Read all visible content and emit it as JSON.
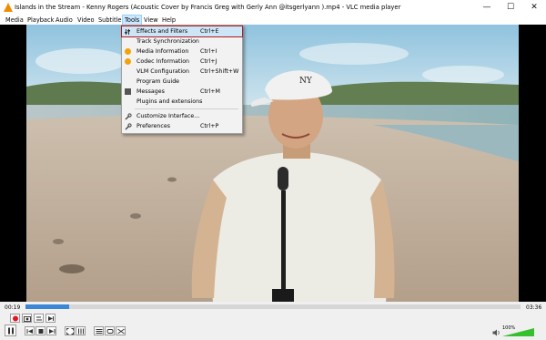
{
  "window": {
    "title": "Islands in the Stream - Kenny Rogers (Acoustic Cover by Francis Greg with Gerly Ann @itsgerlyann ).mp4 - VLC media player",
    "minimize_glyph": "—",
    "maximize_glyph": "☐",
    "close_glyph": "✕"
  },
  "menubar": {
    "items": [
      {
        "label": "Media"
      },
      {
        "label": "Playback"
      },
      {
        "label": "Audio"
      },
      {
        "label": "Video"
      },
      {
        "label": "Subtitle"
      },
      {
        "label": "Tools"
      },
      {
        "label": "View"
      },
      {
        "label": "Help"
      }
    ],
    "open_menu": "Tools"
  },
  "tools_menu": {
    "items": [
      {
        "label": "Effects and Filters",
        "shortcut": "Ctrl+E",
        "icon": "equalizer-icon",
        "highlighted": true
      },
      {
        "label": "Track Synchronization",
        "shortcut": "",
        "icon": ""
      },
      {
        "label": "Media Information",
        "shortcut": "Ctrl+I",
        "icon": "info-warning-icon"
      },
      {
        "label": "Codec Information",
        "shortcut": "Ctrl+J",
        "icon": "info-warning-icon"
      },
      {
        "label": "VLM Configuration",
        "shortcut": "Ctrl+Shift+W",
        "icon": ""
      },
      {
        "label": "Program Guide",
        "shortcut": "",
        "icon": ""
      },
      {
        "label": "Messages",
        "shortcut": "Ctrl+M",
        "icon": "messages-icon"
      },
      {
        "label": "Plugins and extensions",
        "shortcut": "",
        "icon": ""
      },
      {
        "label": "Customize Interface...",
        "shortcut": "",
        "icon": "wrench-icon"
      },
      {
        "label": "Preferences",
        "shortcut": "Ctrl+P",
        "icon": "wrench-icon"
      }
    ]
  },
  "player": {
    "elapsed": "00:19",
    "duration": "03:36",
    "progress_fraction": 0.088,
    "volume": "100%",
    "volume_fraction": 1.0
  },
  "colors": {
    "menu_highlight_outline": "#b51c1c",
    "seek_fill": "#3a87d8",
    "volume_fill": "#35c12e",
    "record_red": "#e81123"
  }
}
